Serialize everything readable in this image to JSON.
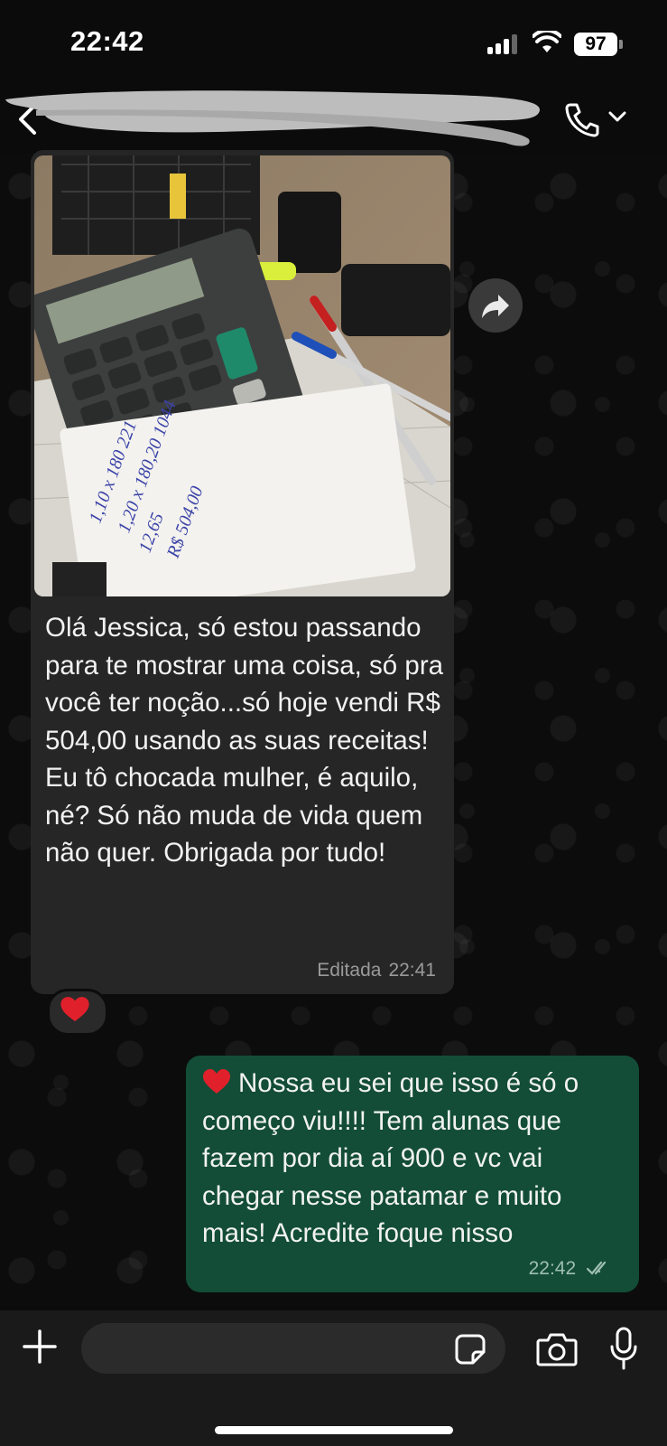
{
  "status_bar": {
    "time": "22:42",
    "battery": "97",
    "icons": [
      "signal-icon",
      "wifi-icon",
      "battery-icon"
    ]
  },
  "header": {
    "contact_name_redacted": true,
    "icons": [
      "back-icon",
      "call-icon",
      "chevron-down-icon"
    ]
  },
  "messages": [
    {
      "direction": "incoming",
      "has_photo": true,
      "photo_handwriting": [
        "1,10 x 180 221",
        "1,20 x 180,20 1044",
        "12,65",
        "R$ 504,00"
      ],
      "text": "Olá Jessica, só estou passando para te mostrar uma coisa, só pra você ter noção...só hoje vendi R$ 504,00 usando as suas receitas!\nEu tô chocada mulher, é aquilo, né? Só não muda de vida quem não quer. Obrigada por tudo!",
      "edited_label": "Editada",
      "time": "22:41",
      "reaction": "❤️"
    },
    {
      "direction": "outgoing",
      "text_emoji": "❤️",
      "text": "Nossa eu sei que isso é só o começo viu!!!! Tem alunas que fazem por dia aí 900 e vc vai chegar nesse patamar e muito mais! Acredite foque nisso",
      "time": "22:42",
      "status": "delivered"
    }
  ],
  "input": {
    "placeholder": "",
    "icons": [
      "plus-icon",
      "sticker-icon",
      "camera-icon",
      "mic-icon"
    ]
  },
  "colors": {
    "background": "#0b0b0b",
    "incoming_bubble": "#262626",
    "outgoing_bubble": "#134d37",
    "meta_text": "#9a9a9a"
  }
}
